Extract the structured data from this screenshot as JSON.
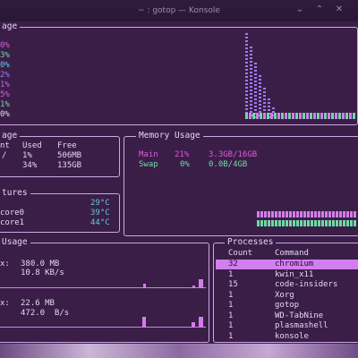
{
  "window": {
    "title": "~ : gotop — Konsole"
  },
  "cpu": {
    "title": "age",
    "percents": [
      "0%",
      "3%",
      "0%",
      "2%",
      "1%",
      "5%",
      "1%",
      "0%"
    ],
    "colors": [
      "#e05ad8",
      "#6fd9a6",
      "#5fc9dd",
      "#9b7cf0",
      "#b46be6",
      "#e05ad8",
      "#6fd9a6",
      "#e4d6ee"
    ]
  },
  "disk": {
    "title": "age",
    "headers": [
      "nt",
      "Used",
      "Free"
    ],
    "rows": [
      [
        "/",
        "1%",
        "506MB"
      ],
      [
        "",
        "34%",
        "135GB"
      ]
    ]
  },
  "memory": {
    "title": "Memory Usage",
    "rows": [
      {
        "name": "Main",
        "percent": "21%",
        "value": "3.3GB/16GB"
      },
      {
        "name": "Swap",
        "percent": "0%",
        "value": "0.0B/4GB"
      }
    ]
  },
  "temps": {
    "title": "tures",
    "rows": [
      {
        "name": "",
        "value": "29°C"
      },
      {
        "name": "core0",
        "value": "39°C"
      },
      {
        "name": "core1",
        "value": "44°C"
      }
    ]
  },
  "network": {
    "title": " Usage",
    "rx": {
      "total": "380.0 MB",
      "rate": "10.8 KB/s",
      "total_label": "x:",
      "rate_label": ""
    },
    "tx": {
      "total": "22.6 MB",
      "rate": "472.0  B/s",
      "total_label": "x:",
      "rate_label": ""
    }
  },
  "processes": {
    "title": "Processes",
    "headers": {
      "count": "Count",
      "command": "Command"
    },
    "rows": [
      {
        "count": "32",
        "command": "chromium"
      },
      {
        "count": "1",
        "command": "kwin_x11"
      },
      {
        "count": "15",
        "command": "code-insiders"
      },
      {
        "count": "1",
        "command": "Xorg"
      },
      {
        "count": "1",
        "command": "gotop"
      },
      {
        "count": "1",
        "command": "WD-TabNine"
      },
      {
        "count": "1",
        "command": "plasmashell"
      },
      {
        "count": "1",
        "command": "konsole"
      }
    ]
  }
}
